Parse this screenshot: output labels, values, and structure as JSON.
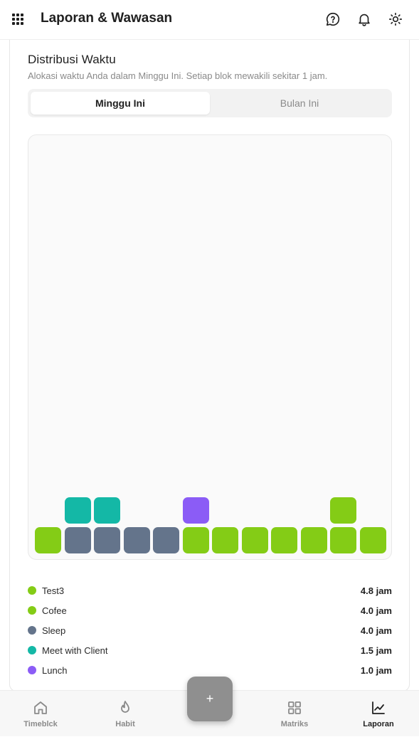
{
  "header": {
    "title": "Laporan & Wawasan"
  },
  "section": {
    "title": "Distribusi Waktu",
    "subtitle": "Alokasi waktu Anda dalam Minggu Ini. Setiap blok mewakili sekitar 1 jam."
  },
  "tabs": [
    {
      "label": "Minggu Ini",
      "active": true
    },
    {
      "label": "Bulan Ini",
      "active": false
    }
  ],
  "colors": {
    "lime": "#84cc16",
    "slate": "#64748b",
    "teal": "#14b8a6",
    "purple": "#8b5cf6"
  },
  "blocks": {
    "bottom_row": [
      "lime",
      "slate",
      "slate",
      "slate",
      "slate",
      "lime",
      "lime",
      "lime",
      "lime",
      "lime",
      "lime",
      "lime"
    ],
    "top_row": [
      null,
      "teal",
      "teal",
      null,
      null,
      "purple",
      null,
      null,
      null,
      null,
      "lime",
      null
    ]
  },
  "legend": [
    {
      "label": "Test3",
      "value": "4.8 jam",
      "color": "#84cc16"
    },
    {
      "label": "Cofee",
      "value": "4.0 jam",
      "color": "#84cc16"
    },
    {
      "label": "Sleep",
      "value": "4.0 jam",
      "color": "#64748b"
    },
    {
      "label": "Meet with Client",
      "value": "1.5 jam",
      "color": "#14b8a6"
    },
    {
      "label": "Lunch",
      "value": "1.0 jam",
      "color": "#8b5cf6"
    }
  ],
  "fab": {
    "label": "+"
  },
  "nav": [
    {
      "label": "Timeblck",
      "icon": "home-icon",
      "active": false
    },
    {
      "label": "Habit",
      "icon": "flame-icon",
      "active": false
    },
    {
      "label": "Matriks",
      "icon": "grid-icon",
      "active": false
    },
    {
      "label": "Laporan",
      "icon": "chart-line-icon",
      "active": true
    }
  ]
}
